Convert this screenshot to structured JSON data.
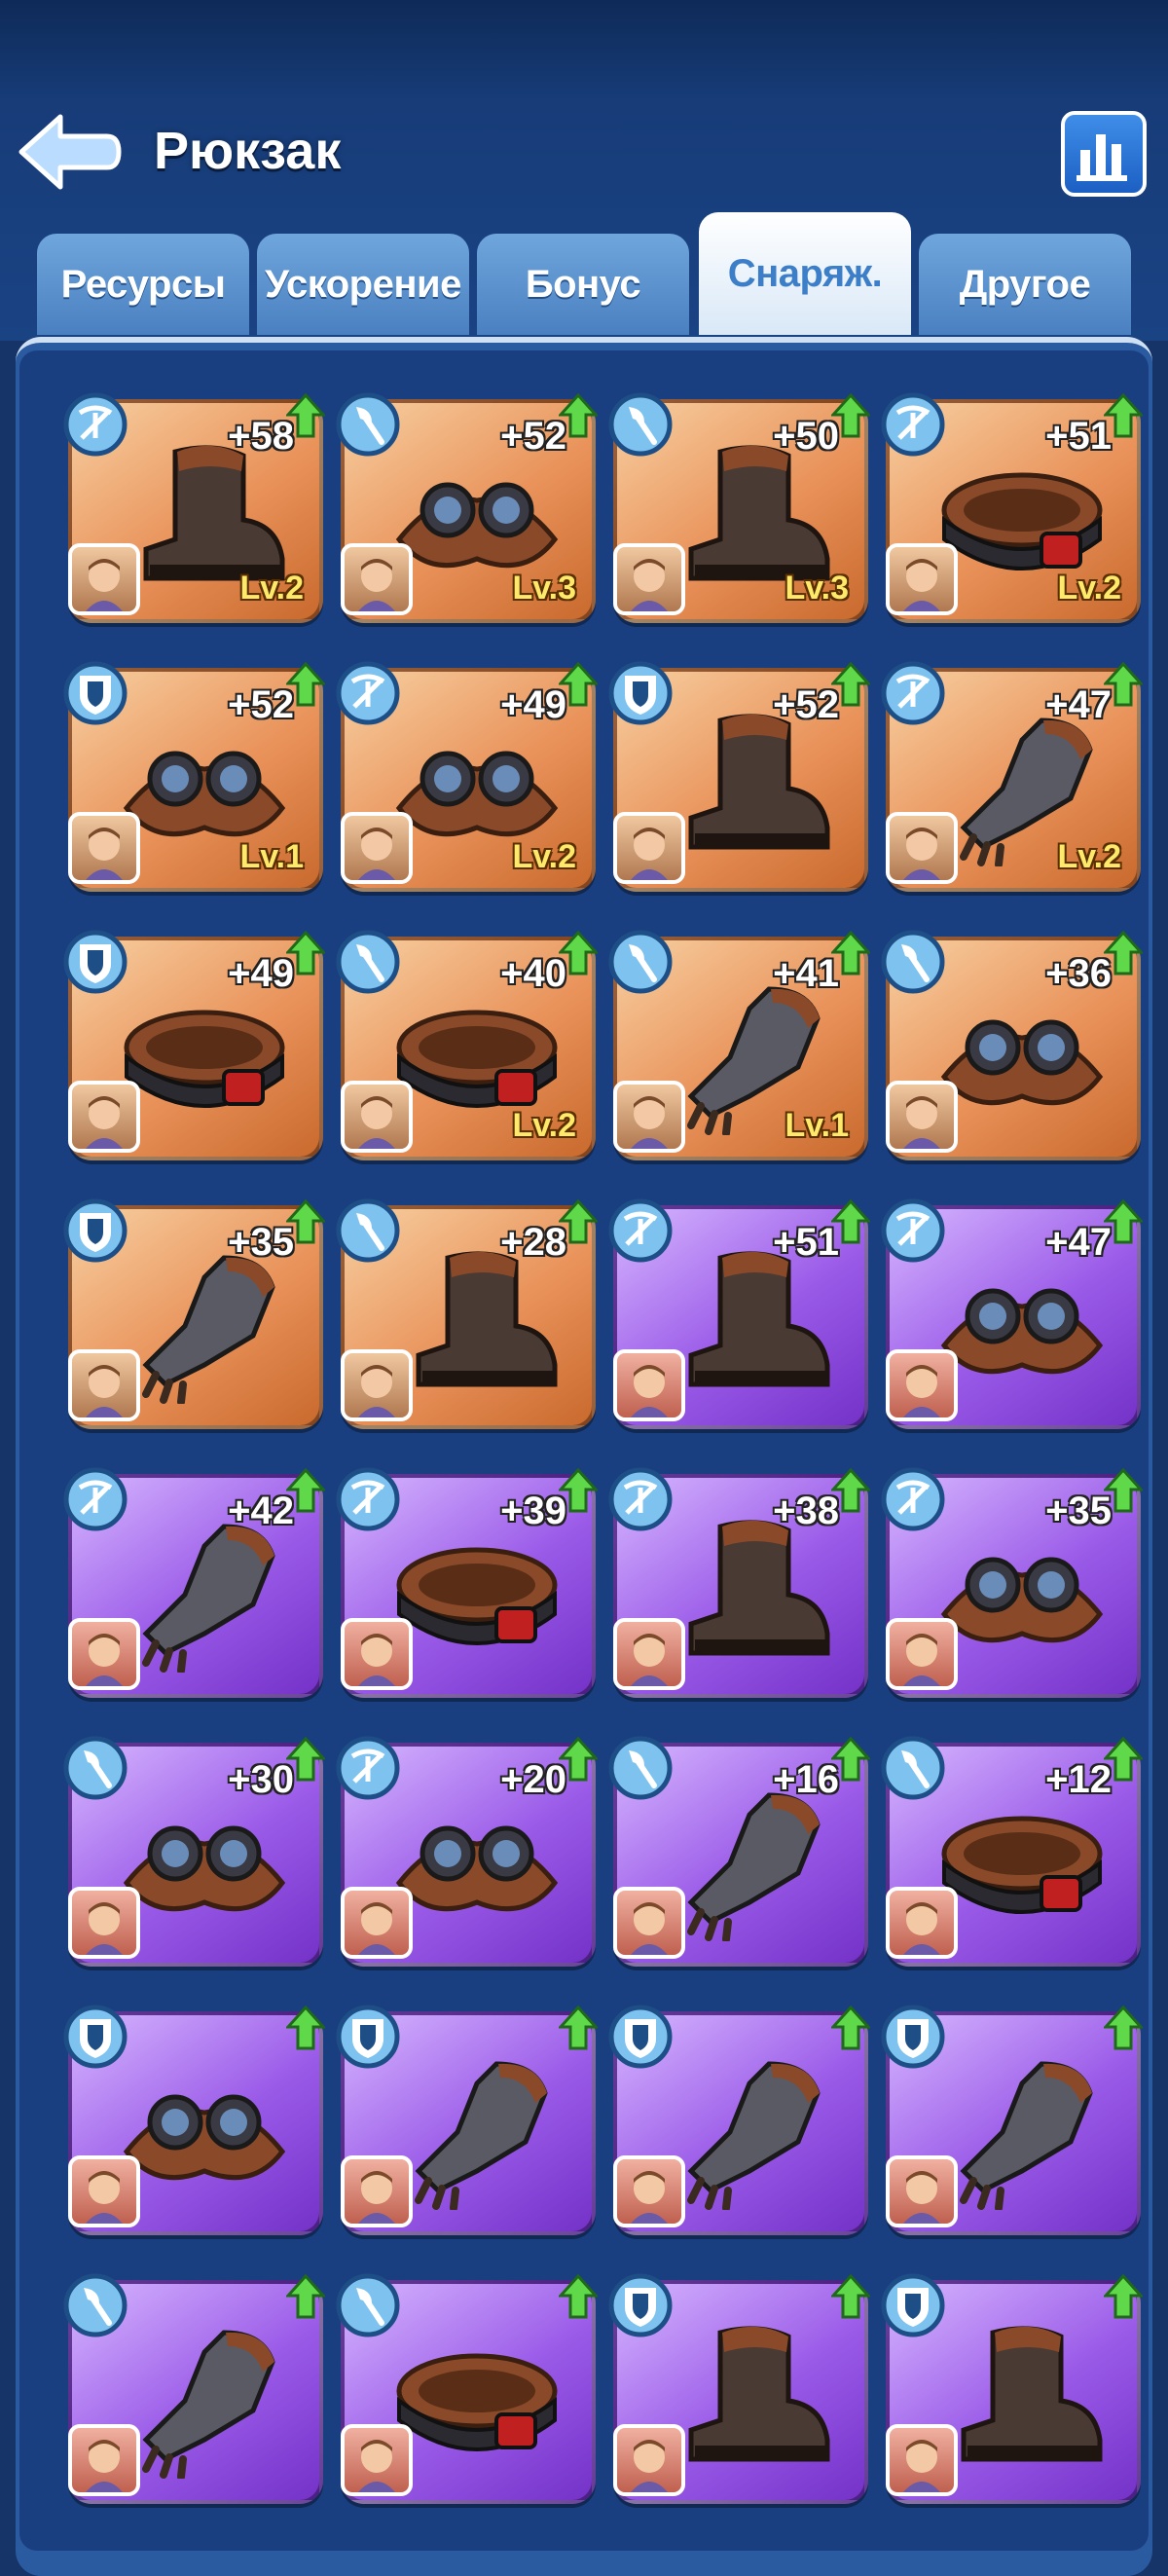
{
  "header": {
    "title": "Рюкзак",
    "back_icon": "back-arrow-icon",
    "stats_icon": "bar-chart-icon"
  },
  "tabs": [
    {
      "label": "Ресурсы",
      "active": false
    },
    {
      "label": "Ускорение",
      "active": false
    },
    {
      "label": "Бонус",
      "active": false
    },
    {
      "label": "Снаряж.",
      "active": true
    },
    {
      "label": "Другое",
      "active": false
    }
  ],
  "colors": {
    "orange_rarity": "#e9925a",
    "purple_rarity": "#9a5ae8",
    "level_text": "#ffe96a"
  },
  "items": [
    {
      "type": "crossbow",
      "bonus": "+58",
      "level": "Lv.2",
      "rarity": "orange",
      "gear": "boot"
    },
    {
      "type": "axe",
      "bonus": "+52",
      "level": "Lv.3",
      "rarity": "orange",
      "gear": "goggles"
    },
    {
      "type": "axe",
      "bonus": "+50",
      "level": "Lv.3",
      "rarity": "orange",
      "gear": "boot"
    },
    {
      "type": "crossbow",
      "bonus": "+51",
      "level": "Lv.2",
      "rarity": "orange",
      "gear": "belt"
    },
    {
      "type": "shield",
      "bonus": "+52",
      "level": "Lv.1",
      "rarity": "orange",
      "gear": "goggles"
    },
    {
      "type": "crossbow",
      "bonus": "+49",
      "level": "Lv.2",
      "rarity": "orange",
      "gear": "goggles"
    },
    {
      "type": "shield",
      "bonus": "+52",
      "level": "",
      "rarity": "orange",
      "gear": "boot"
    },
    {
      "type": "crossbow",
      "bonus": "+47",
      "level": "Lv.2",
      "rarity": "orange",
      "gear": "glove"
    },
    {
      "type": "shield",
      "bonus": "+49",
      "level": "",
      "rarity": "orange",
      "gear": "belt"
    },
    {
      "type": "axe",
      "bonus": "+40",
      "level": "Lv.2",
      "rarity": "orange",
      "gear": "belt"
    },
    {
      "type": "axe",
      "bonus": "+41",
      "level": "Lv.1",
      "rarity": "orange",
      "gear": "glove"
    },
    {
      "type": "axe",
      "bonus": "+36",
      "level": "",
      "rarity": "orange",
      "gear": "goggles"
    },
    {
      "type": "shield",
      "bonus": "+35",
      "level": "",
      "rarity": "orange",
      "gear": "glove"
    },
    {
      "type": "axe",
      "bonus": "+28",
      "level": "",
      "rarity": "orange",
      "gear": "boot"
    },
    {
      "type": "crossbow",
      "bonus": "+51",
      "level": "",
      "rarity": "purple",
      "gear": "boot"
    },
    {
      "type": "crossbow",
      "bonus": "+47",
      "level": "",
      "rarity": "purple",
      "gear": "goggles"
    },
    {
      "type": "crossbow",
      "bonus": "+42",
      "level": "",
      "rarity": "purple",
      "gear": "glove"
    },
    {
      "type": "crossbow",
      "bonus": "+39",
      "level": "",
      "rarity": "purple",
      "gear": "belt"
    },
    {
      "type": "crossbow",
      "bonus": "+38",
      "level": "",
      "rarity": "purple",
      "gear": "boot"
    },
    {
      "type": "crossbow",
      "bonus": "+35",
      "level": "",
      "rarity": "purple",
      "gear": "goggles"
    },
    {
      "type": "axe",
      "bonus": "+30",
      "level": "",
      "rarity": "purple",
      "gear": "goggles"
    },
    {
      "type": "crossbow",
      "bonus": "+20",
      "level": "",
      "rarity": "purple",
      "gear": "goggles"
    },
    {
      "type": "axe",
      "bonus": "+16",
      "level": "",
      "rarity": "purple",
      "gear": "glove"
    },
    {
      "type": "axe",
      "bonus": "+12",
      "level": "",
      "rarity": "purple",
      "gear": "belt"
    },
    {
      "type": "shield",
      "bonus": "",
      "level": "",
      "rarity": "purple",
      "gear": "goggles"
    },
    {
      "type": "shield",
      "bonus": "",
      "level": "",
      "rarity": "purple",
      "gear": "glove"
    },
    {
      "type": "shield",
      "bonus": "",
      "level": "",
      "rarity": "purple",
      "gear": "glove"
    },
    {
      "type": "shield",
      "bonus": "",
      "level": "",
      "rarity": "purple",
      "gear": "glove"
    },
    {
      "type": "axe",
      "bonus": "",
      "level": "",
      "rarity": "purple",
      "gear": "glove"
    },
    {
      "type": "axe",
      "bonus": "",
      "level": "",
      "rarity": "purple",
      "gear": "belt"
    },
    {
      "type": "shield",
      "bonus": "",
      "level": "",
      "rarity": "purple",
      "gear": "boot"
    },
    {
      "type": "shield",
      "bonus": "",
      "level": "",
      "rarity": "purple",
      "gear": "boot"
    }
  ]
}
